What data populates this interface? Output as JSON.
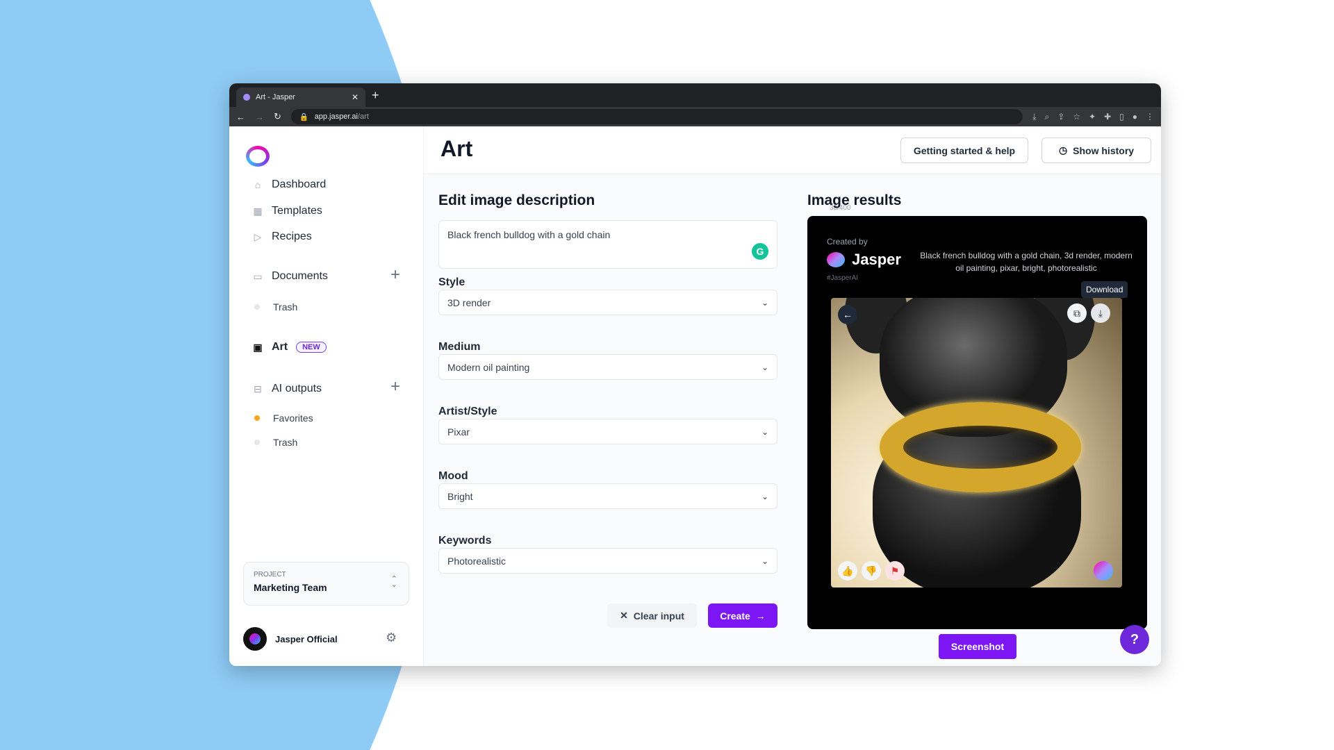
{
  "browser": {
    "tab_title": "Art - Jasper",
    "url_host": "app.jasper.ai",
    "url_path": "/art"
  },
  "sidebar": {
    "items": [
      {
        "label": "Dashboard"
      },
      {
        "label": "Templates"
      },
      {
        "label": "Recipes"
      }
    ],
    "documents": {
      "label": "Documents",
      "trash": "Trash"
    },
    "art": {
      "label": "Art",
      "badge": "NEW"
    },
    "ai_outputs": {
      "label": "AI outputs",
      "favorites": "Favorites",
      "trash": "Trash"
    },
    "project": {
      "label": "PROJECT",
      "value": "Marketing Team"
    },
    "user": {
      "name": "Jasper Official"
    }
  },
  "header": {
    "title": "Art",
    "help_label": "Getting started & help",
    "history_label": "Show history"
  },
  "form": {
    "heading": "Edit image description",
    "counter": "38/400",
    "description": "Black french bulldog with a gold chain",
    "fields": [
      {
        "label": "Style",
        "value": "3D render"
      },
      {
        "label": "Medium",
        "value": "Modern oil painting"
      },
      {
        "label": "Artist/Style",
        "value": "Pixar"
      },
      {
        "label": "Mood",
        "value": "Bright"
      },
      {
        "label": "Keywords",
        "value": "Photorealistic"
      }
    ],
    "clear_label": "Clear input",
    "create_label": "Create"
  },
  "results": {
    "heading": "Image results",
    "created_by": "Created by",
    "brand": "Jasper",
    "hashtag": "#JasperAI",
    "prompt": "Black french bulldog with a gold chain, 3d render, modern oil painting, pixar, bright, photorealistic",
    "tooltip": "Download",
    "screenshot_label": "Screenshot"
  },
  "help": "?",
  "colors": {
    "accent": "#7c16f5",
    "background": "#8ecbf5",
    "favorites_dot": "#f5a623"
  }
}
